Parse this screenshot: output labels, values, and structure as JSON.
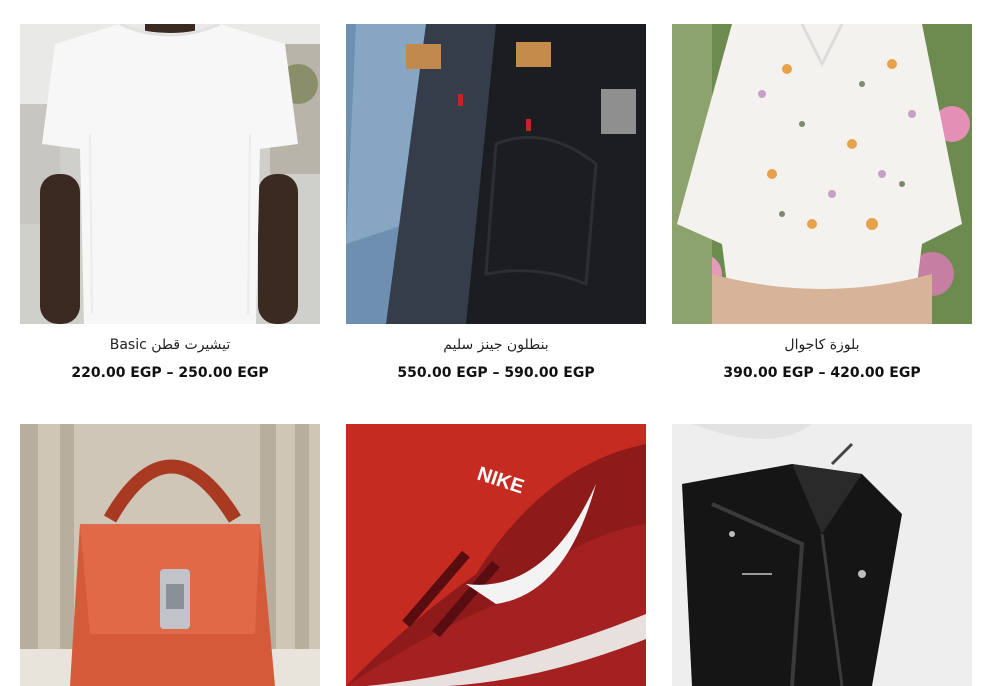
{
  "products": [
    {
      "title": "تيشيرت قطن Basic",
      "price": "220.00 EGP – 250.00 EGP",
      "image": "white-tshirt"
    },
    {
      "title": "بنطلون جينز سليم",
      "price": "550.00 EGP – 590.00 EGP",
      "image": "jeans-stack"
    },
    {
      "title": "بلوزة كاجوال",
      "price": "390.00 EGP – 420.00 EGP",
      "image": "floral-blouse"
    },
    {
      "image": "red-handbag"
    },
    {
      "image": "red-sneaker"
    },
    {
      "image": "leather-jacket"
    }
  ]
}
